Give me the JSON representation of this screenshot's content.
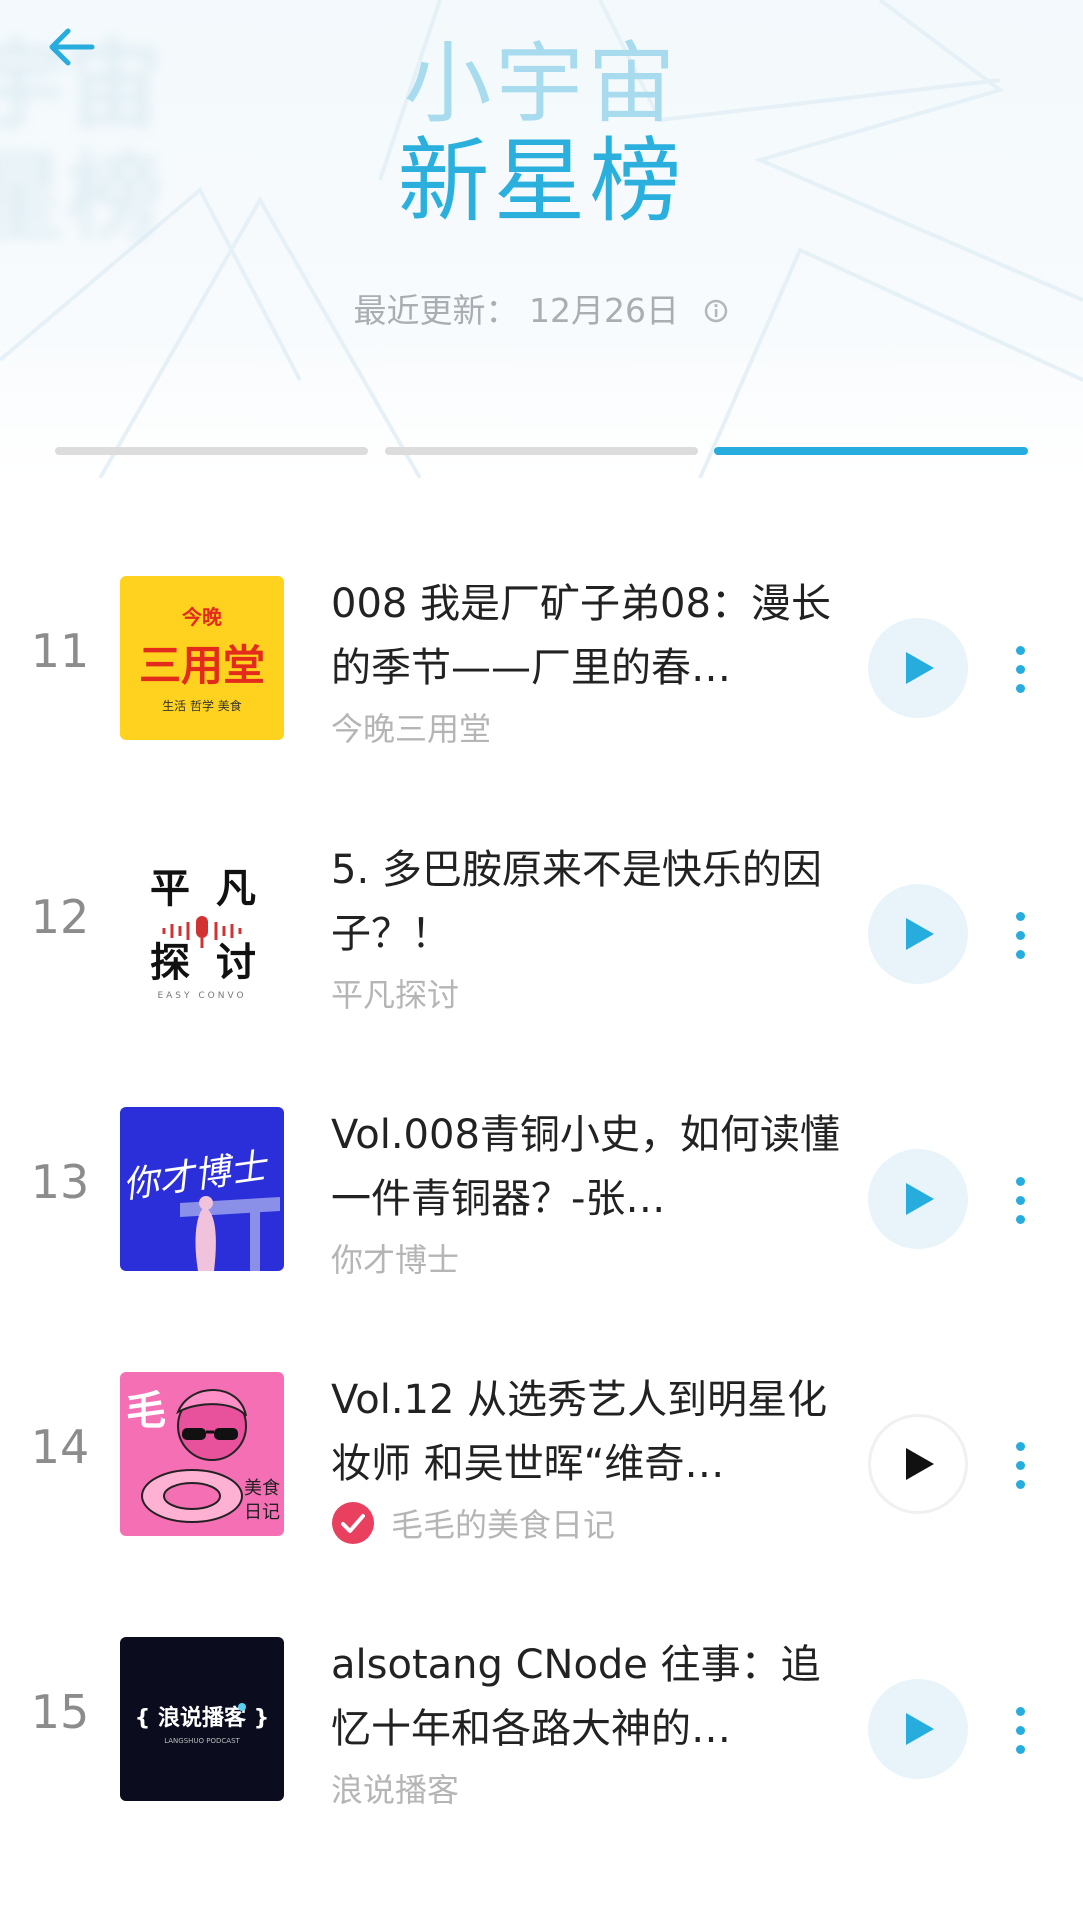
{
  "header": {
    "title_line1": "小宇宙",
    "title_line2": "新星榜",
    "ghost_line1": "宇宙",
    "ghost_line2": "星榜",
    "update_label": "最近更新：",
    "update_date": "12月26日",
    "tabs_count": 3,
    "active_tab": 3,
    "accent_color": "#27acde"
  },
  "items": [
    {
      "rank": "11",
      "title": "008 我是厂矿子弟08：漫长的季节——厂里的春…",
      "author": "今晚三用堂",
      "verified": false,
      "cover": {
        "lines": [
          "今晚",
          "三用堂",
          "生活 哲学 美食"
        ],
        "bg": "#ffd21f",
        "fg": "#e32b1c"
      },
      "play_icon": "play-icon"
    },
    {
      "rank": "12",
      "title": "5. 多巴胺原来不是快乐的因子？！",
      "author": "平凡探讨",
      "verified": false,
      "cover": {
        "lines": [
          "平",
          "凡",
          "探",
          "讨",
          "EASY CONVO"
        ],
        "bg": "#ffffff",
        "fg": "#111111"
      },
      "play_icon": "play-icon"
    },
    {
      "rank": "13",
      "title": "Vol.008青铜小史，如何读懂一件青铜器？-张…",
      "author": "你才博士",
      "verified": false,
      "cover": {
        "lines": [
          "你才博士"
        ],
        "bg": "#2b2fd9",
        "fg": "#ffffff"
      },
      "play_icon": "play-icon"
    },
    {
      "rank": "14",
      "title": "Vol.12 从选秀艺人到明星化妆师 和吴世晖“维奇…",
      "author": "毛毛的美食日记",
      "verified": true,
      "cover": {
        "lines": [
          "毛",
          "美食",
          "日记"
        ],
        "bg": "#f56fb4",
        "fg": "#ffffff"
      },
      "play_icon": "play-icon"
    },
    {
      "rank": "15",
      "title": "alsotang CNode 往事：追忆十年和各路大神的…",
      "author": "浪说播客",
      "verified": false,
      "cover": {
        "lines": [
          "{ 浪说播客 }",
          "LANGSHUO PODCAST"
        ],
        "bg": "#0b0d1f",
        "fg": "#ffffff"
      },
      "play_icon": "play-icon"
    }
  ]
}
